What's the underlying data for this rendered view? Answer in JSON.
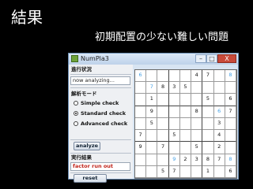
{
  "slide": {
    "title": "結果",
    "subtitle": "初期配置の少ない難しい問題"
  },
  "window": {
    "title": "NumPla3",
    "minimize": "–",
    "maximize": "□",
    "close": "X"
  },
  "panel": {
    "status_heading": "進行状況",
    "status_text": "now analyzing...",
    "mode_heading": "解析モード",
    "modes": [
      {
        "label": "Simple check",
        "selected": false
      },
      {
        "label": "Standard check",
        "selected": true
      },
      {
        "label": "Advanced check",
        "selected": false
      }
    ],
    "analyze_button": "analyze",
    "result_heading": "実行結果",
    "result_text": "factor run out",
    "reset_button": "reset"
  },
  "grid": {
    "cells": [
      [
        {
          "v": "6",
          "hint": true
        },
        {
          "v": "",
          "hint": false
        },
        {
          "v": "",
          "hint": false
        },
        {
          "v": "",
          "hint": false
        },
        {
          "v": "",
          "hint": false
        },
        {
          "v": "4",
          "hint": false
        },
        {
          "v": "7",
          "hint": false
        },
        {
          "v": "",
          "hint": false
        },
        {
          "v": "8",
          "hint": true
        }
      ],
      [
        {
          "v": "",
          "hint": false
        },
        {
          "v": "7",
          "hint": true
        },
        {
          "v": "8",
          "hint": false
        },
        {
          "v": "3",
          "hint": false
        },
        {
          "v": "5",
          "hint": false
        },
        {
          "v": "",
          "hint": false
        },
        {
          "v": "",
          "hint": false
        },
        {
          "v": "",
          "hint": false
        },
        {
          "v": "",
          "hint": false
        }
      ],
      [
        {
          "v": "",
          "hint": false
        },
        {
          "v": "1",
          "hint": false
        },
        {
          "v": "",
          "hint": false
        },
        {
          "v": "",
          "hint": false
        },
        {
          "v": "",
          "hint": false
        },
        {
          "v": "",
          "hint": false
        },
        {
          "v": "5",
          "hint": false
        },
        {
          "v": "",
          "hint": false
        },
        {
          "v": "6",
          "hint": false
        }
      ],
      [
        {
          "v": "",
          "hint": false
        },
        {
          "v": "9",
          "hint": false
        },
        {
          "v": "",
          "hint": false
        },
        {
          "v": "",
          "hint": false
        },
        {
          "v": "",
          "hint": false
        },
        {
          "v": "8",
          "hint": false
        },
        {
          "v": "",
          "hint": false
        },
        {
          "v": "6",
          "hint": true
        },
        {
          "v": "7",
          "hint": false
        }
      ],
      [
        {
          "v": "",
          "hint": false
        },
        {
          "v": "5",
          "hint": false
        },
        {
          "v": "",
          "hint": false
        },
        {
          "v": "",
          "hint": false
        },
        {
          "v": "",
          "hint": false
        },
        {
          "v": "",
          "hint": false
        },
        {
          "v": "",
          "hint": false
        },
        {
          "v": "3",
          "hint": false
        },
        {
          "v": "",
          "hint": false
        }
      ],
      [
        {
          "v": "7",
          "hint": false
        },
        {
          "v": "",
          "hint": false
        },
        {
          "v": "",
          "hint": false
        },
        {
          "v": "5",
          "hint": false
        },
        {
          "v": "",
          "hint": false
        },
        {
          "v": "",
          "hint": false
        },
        {
          "v": "",
          "hint": false
        },
        {
          "v": "4",
          "hint": false
        },
        {
          "v": "",
          "hint": false
        }
      ],
      [
        {
          "v": "9",
          "hint": false
        },
        {
          "v": "",
          "hint": false
        },
        {
          "v": "7",
          "hint": false
        },
        {
          "v": "",
          "hint": false
        },
        {
          "v": "",
          "hint": false
        },
        {
          "v": "5",
          "hint": false
        },
        {
          "v": "",
          "hint": false
        },
        {
          "v": "2",
          "hint": false
        },
        {
          "v": "",
          "hint": false
        }
      ],
      [
        {
          "v": "",
          "hint": false
        },
        {
          "v": "",
          "hint": false
        },
        {
          "v": "",
          "hint": false
        },
        {
          "v": "9",
          "hint": true
        },
        {
          "v": "2",
          "hint": false
        },
        {
          "v": "3",
          "hint": false
        },
        {
          "v": "8",
          "hint": false
        },
        {
          "v": "7",
          "hint": false
        },
        {
          "v": "8",
          "hint": true
        }
      ],
      [
        {
          "v": "",
          "hint": false
        },
        {
          "v": "",
          "hint": false
        },
        {
          "v": "5",
          "hint": false
        },
        {
          "v": "7",
          "hint": false
        },
        {
          "v": "",
          "hint": false
        },
        {
          "v": "",
          "hint": false
        },
        {
          "v": "1",
          "hint": false
        },
        {
          "v": "",
          "hint": false
        },
        {
          "v": "6",
          "hint": false
        }
      ]
    ]
  },
  "colors": {
    "background": "#000000",
    "hint_digit": "#4aa3e6",
    "result_text": "#c0241a",
    "close_button": "#c94a3a"
  }
}
